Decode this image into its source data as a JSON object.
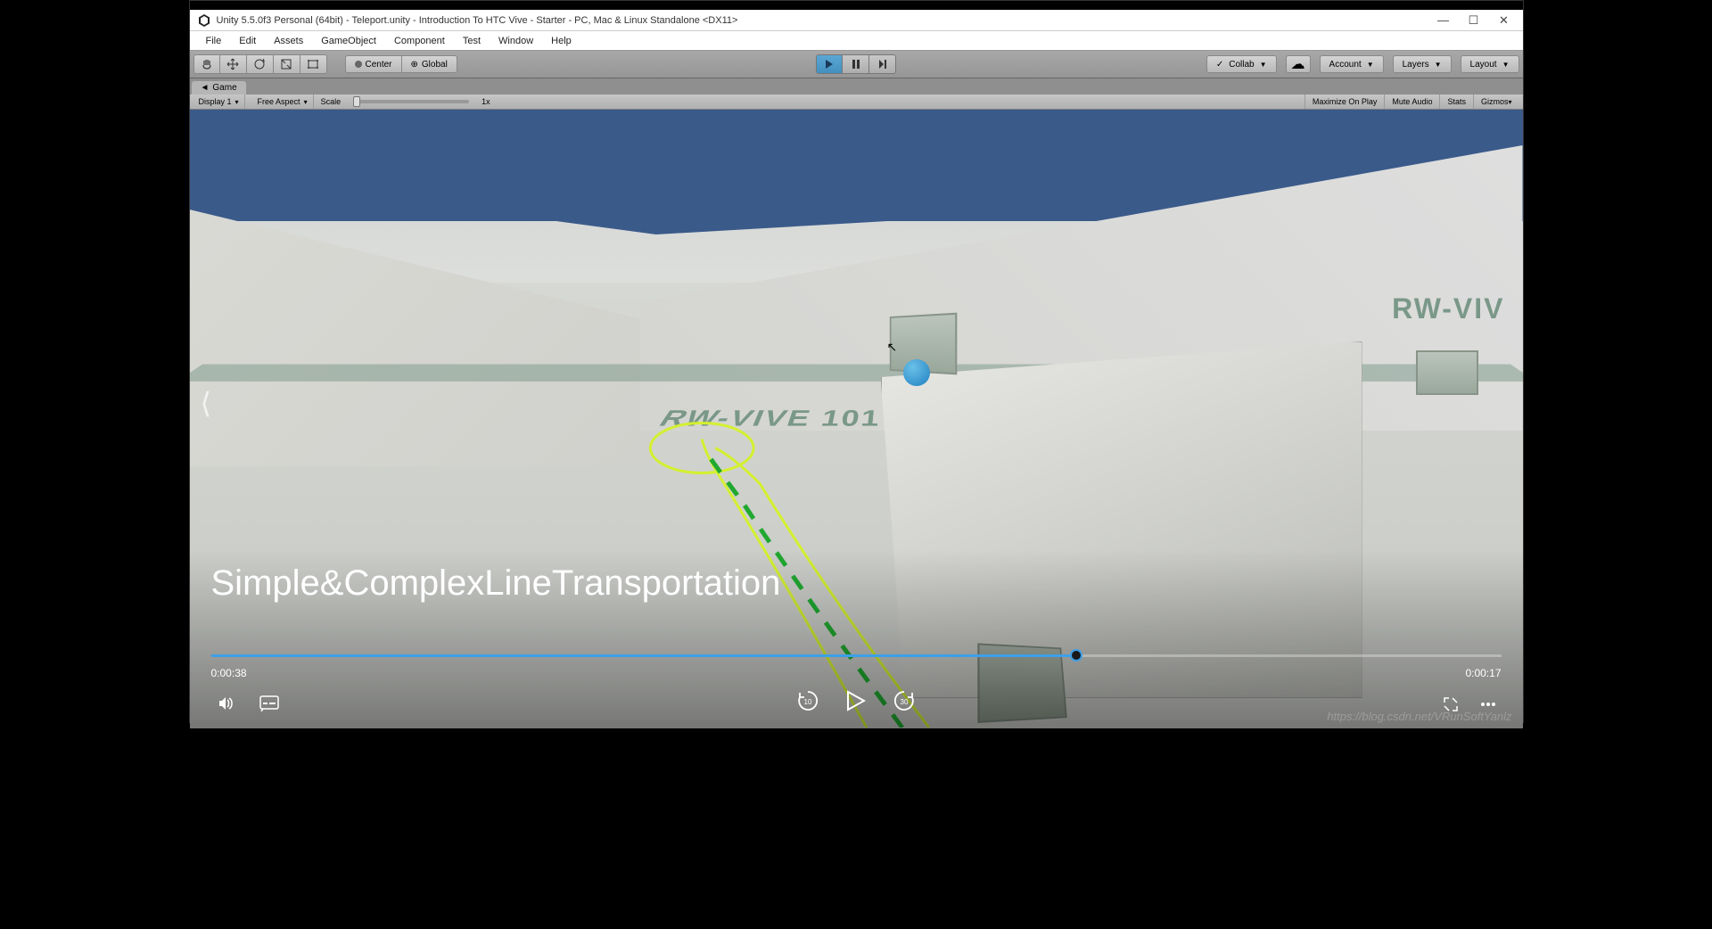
{
  "window": {
    "title": "Unity 5.5.0f3 Personal (64bit) - Teleport.unity - Introduction To HTC Vive - Starter - PC, Mac & Linux Standalone <DX11>"
  },
  "menu": {
    "items": [
      "File",
      "Edit",
      "Assets",
      "GameObject",
      "Component",
      "Test",
      "Window",
      "Help"
    ]
  },
  "toolbar": {
    "pivot": "Center",
    "handle": "Global",
    "collab": "Collab",
    "account": "Account",
    "layers": "Layers",
    "layout": "Layout"
  },
  "game_tab": {
    "label": "Game"
  },
  "game_toolbar": {
    "display": "Display 1",
    "aspect": "Free Aspect",
    "scale_label": "Scale",
    "scale_value": "1x",
    "maximize": "Maximize On Play",
    "mute": "Mute Audio",
    "stats": "Stats",
    "gizmos": "Gizmos"
  },
  "scene": {
    "floor_text_1": "RW-VIVE 101",
    "floor_text_2": "RW-VIV"
  },
  "video": {
    "title": "Simple&ComplexLineTransportation",
    "time_elapsed": "0:00:38",
    "time_remaining": "0:00:17",
    "skip_back": "10",
    "skip_forward": "30"
  },
  "watermark": "https://blog.csdn.net/VRunSoftYanlz"
}
